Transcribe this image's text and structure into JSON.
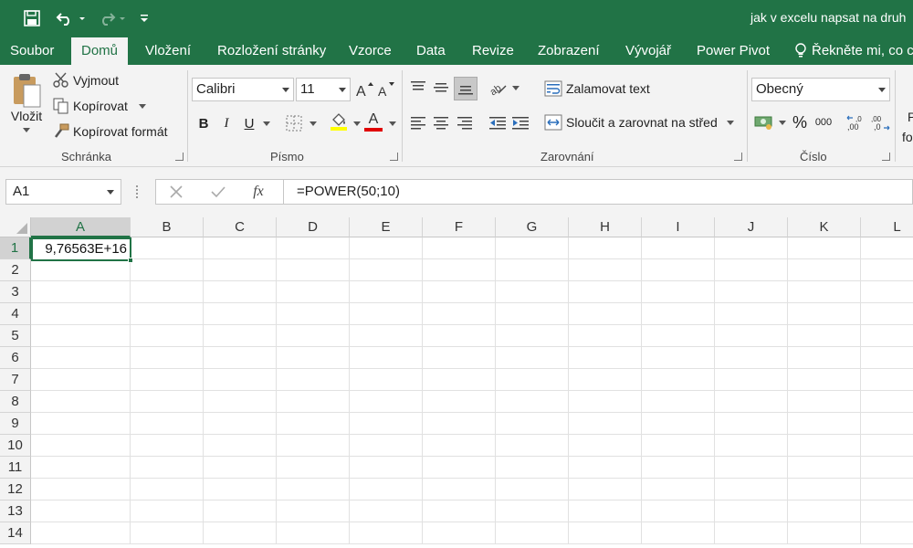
{
  "window": {
    "title": "jak v excelu napsat na druh"
  },
  "tabs": [
    {
      "label": "Soubor"
    },
    {
      "label": "Domů"
    },
    {
      "label": "Vložení"
    },
    {
      "label": "Rozložení stránky"
    },
    {
      "label": "Vzorce"
    },
    {
      "label": "Data"
    },
    {
      "label": "Revize"
    },
    {
      "label": "Zobrazení"
    },
    {
      "label": "Vývojář"
    },
    {
      "label": "Power Pivot"
    }
  ],
  "tell_me": "Řekněte mi, co ch",
  "clipboard": {
    "paste": "Vložit",
    "cut": "Vyjmout",
    "copy": "Kopírovat",
    "format_painter": "Kopírovat formát",
    "group": "Schránka"
  },
  "font": {
    "name": "Calibri",
    "size": "11",
    "bold": "B",
    "italic": "I",
    "underline": "U",
    "font_color_letter": "A",
    "group": "Písmo"
  },
  "alignment": {
    "wrap": "Zalamovat text",
    "merge": "Sloučit a zarovnat na střed",
    "group": "Zarovnání"
  },
  "number": {
    "format": "Obecný",
    "percent": "%",
    "thousands": "000",
    "group": "Číslo"
  },
  "styles": {
    "partial1": "P",
    "partial2": "fo"
  },
  "formula_bar": {
    "name_box": "A1",
    "fx": "fx",
    "formula": "=POWER(50;10)"
  },
  "grid": {
    "columns": [
      "A",
      "B",
      "C",
      "D",
      "E",
      "F",
      "G",
      "H",
      "I",
      "J",
      "K",
      "L"
    ],
    "rows": [
      "1",
      "2",
      "3",
      "4",
      "5",
      "6",
      "7",
      "8",
      "9",
      "10",
      "11",
      "12",
      "13",
      "14"
    ],
    "a1_value": "9,76563E+16"
  },
  "colors": {
    "accent": "#217346",
    "ribbon_bg": "#f3f3f3",
    "font_color_bar": "#e00000",
    "highlight_bar": "#ffff00"
  }
}
